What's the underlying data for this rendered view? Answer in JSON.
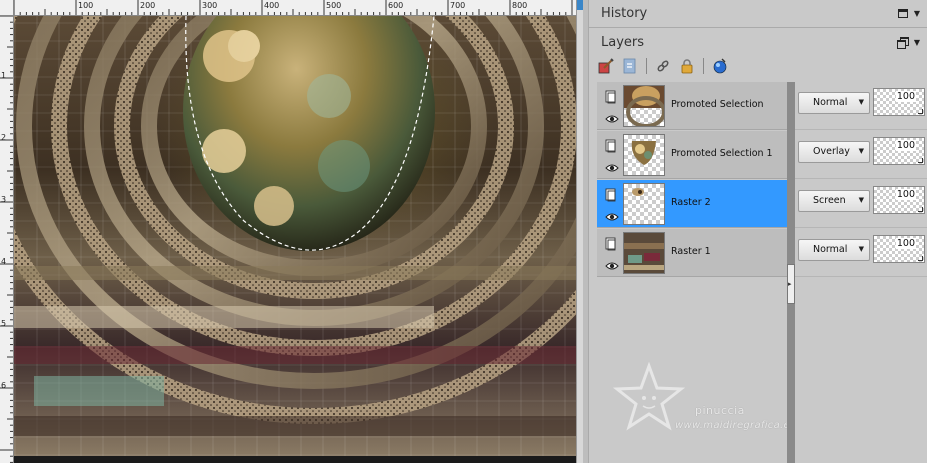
{
  "ruler": {
    "top_labels": [
      "100",
      "200",
      "300",
      "400",
      "500",
      "600",
      "700",
      "800"
    ],
    "left_labels": [
      "1",
      "2",
      "3",
      "4",
      "5",
      "6"
    ]
  },
  "history": {
    "title": "History"
  },
  "layers": {
    "title": "Layers",
    "rows": [
      {
        "name": "Promoted Selection",
        "blend": "Normal",
        "opacity": "100",
        "selected": false
      },
      {
        "name": "Promoted Selection 1",
        "blend": "Overlay",
        "opacity": "100",
        "selected": false
      },
      {
        "name": "Raster 2",
        "blend": "Screen",
        "opacity": "100",
        "selected": true
      },
      {
        "name": "Raster 1",
        "blend": "Normal",
        "opacity": "100",
        "selected": false
      }
    ]
  },
  "watermark": {
    "name": "pinuccia",
    "url": "www.maidiregrafica.eu"
  },
  "colors": {
    "selection": "#3399ff",
    "panel": "#c9c9c9",
    "row": "#bdbdbd"
  }
}
